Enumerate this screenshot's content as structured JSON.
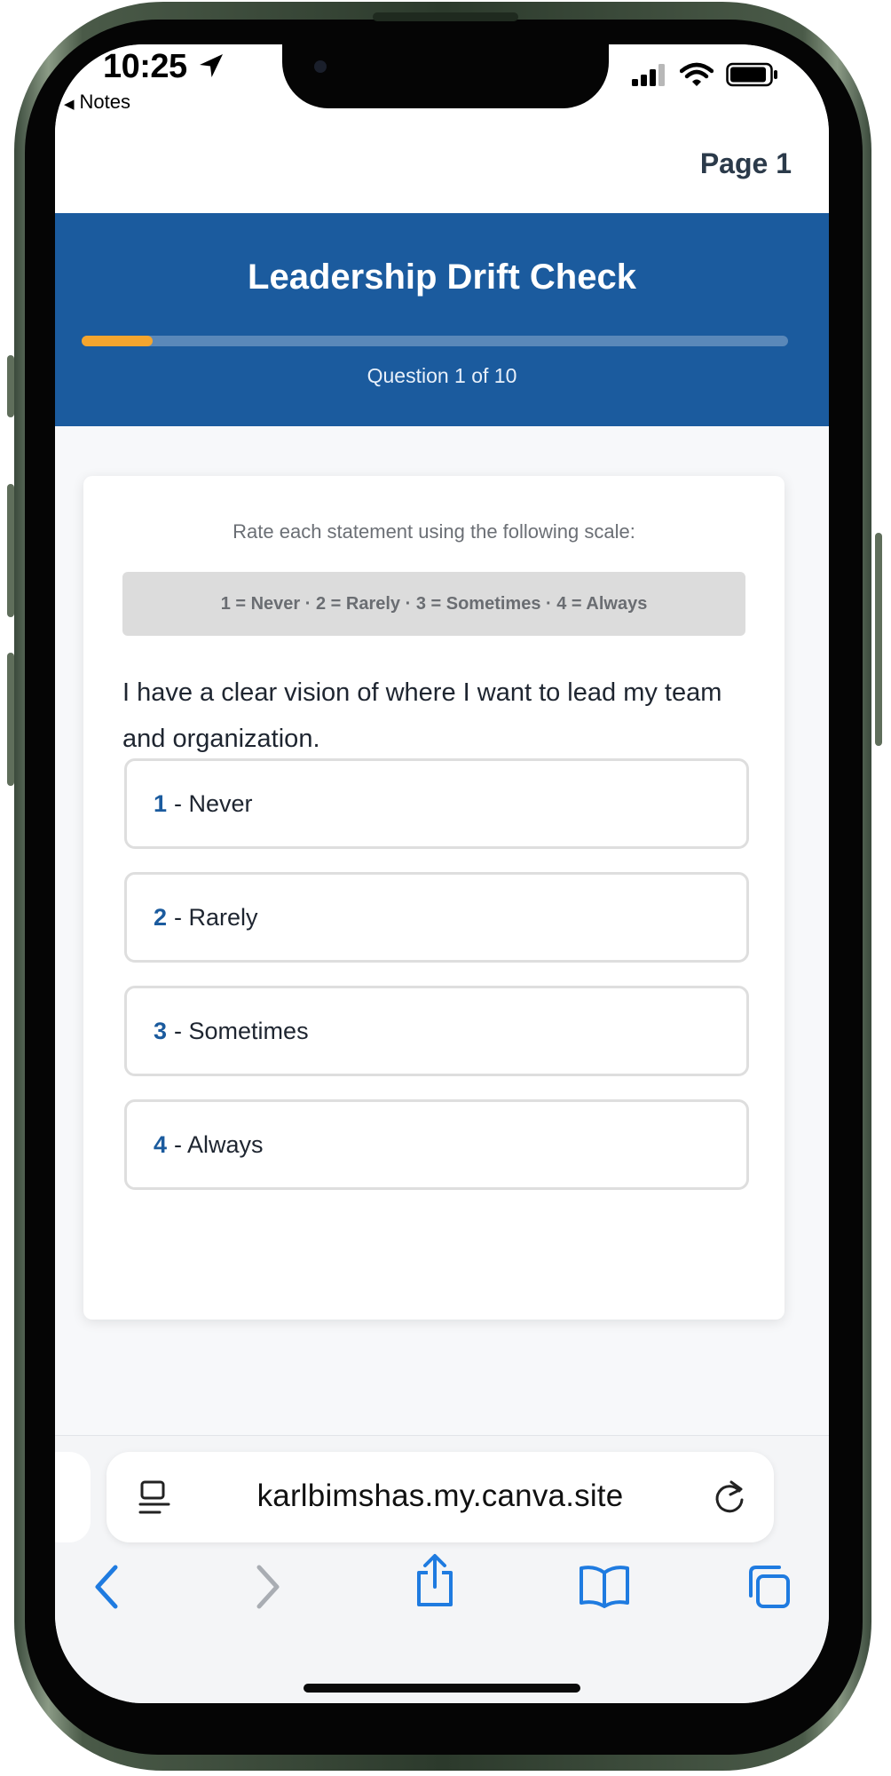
{
  "status_bar": {
    "time": "10:25",
    "back_app": "Notes"
  },
  "page": {
    "page_label": "Page 1"
  },
  "quiz": {
    "title": "Leadership Drift Check",
    "progress_fraction": 0.1,
    "progress_text": "Question 1 of 10",
    "accent_color": "#1b5b9e",
    "progress_color": "#f4a52e"
  },
  "card": {
    "scale_intro": "Rate each statement using the following scale:",
    "scale_legend": "1 = Never · 2 = Rarely · 3 = Sometimes · 4 = Always",
    "question": "I have a clear vision of where I want to lead my team and organization.",
    "options": [
      {
        "number": "1",
        "label": "- Never"
      },
      {
        "number": "2",
        "label": "- Rarely"
      },
      {
        "number": "3",
        "label": "- Sometimes"
      },
      {
        "number": "4",
        "label": "- Always"
      }
    ]
  },
  "browser": {
    "url": "karlbimshas.my.canva.site",
    "icons": [
      "reader-icon",
      "reload-icon",
      "back-icon",
      "forward-icon",
      "share-icon",
      "bookmarks-icon",
      "tabs-icon"
    ]
  }
}
